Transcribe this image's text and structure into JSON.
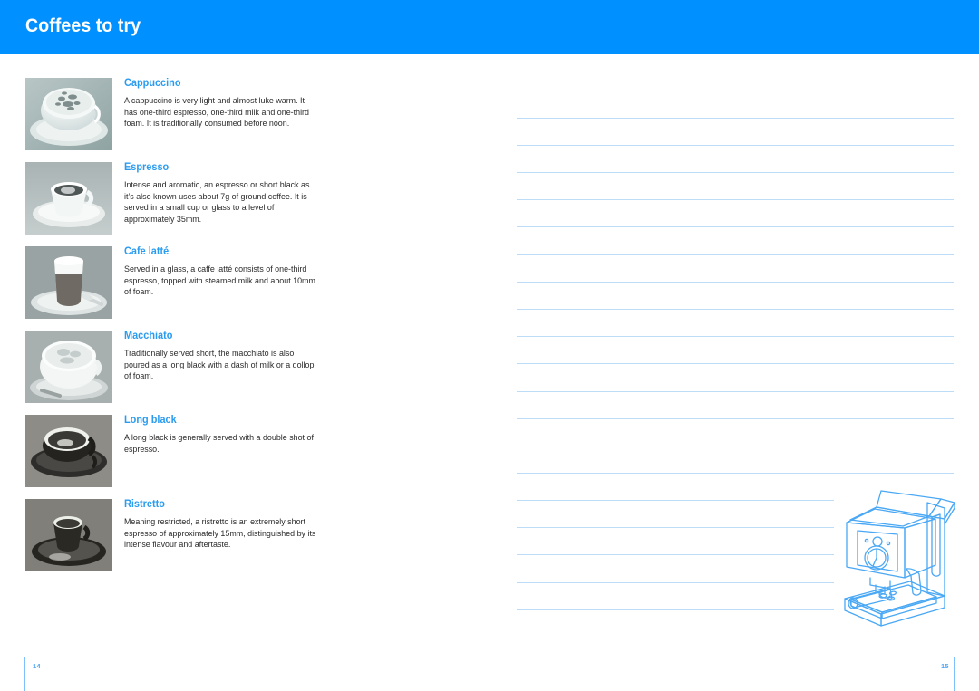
{
  "header": {
    "title": "Coffees to try",
    "bar_color": "#0090ff"
  },
  "theme": {
    "accent_blue": "#0090ff",
    "heading_blue": "#2a9cf0",
    "rule_line_blue": "#bcdcf8",
    "body_text": "#2b2b2b",
    "page_number_blue": "#4da6f5"
  },
  "coffees": [
    {
      "name": "Cappuccino",
      "description": "A cappuccino is very light and almost luke warm. It has one-third espresso, one-third milk and one-third foam. It is traditionally consumed before noon.",
      "thumbnail": "cappuccino-cup-photo"
    },
    {
      "name": "Espresso",
      "description": "Intense and aromatic, an espresso or short black as it’s also known uses about 7g of ground coffee. It is served in a small cup or glass to a level of approximately 35mm.",
      "thumbnail": "espresso-cup-photo"
    },
    {
      "name": "Cafe latté",
      "description": "Served in a glass, a caffe latté consists of one-third espresso, topped with steamed milk and about 10mm of foam.",
      "thumbnail": "cafe-latte-glass-photo"
    },
    {
      "name": "Macchiato",
      "description": "Traditionally served short, the macchiato is also poured as a long black with a dash of milk or a dollop of foam.",
      "thumbnail": "macchiato-cup-photo"
    },
    {
      "name": "Long black",
      "description": "A long black is generally served with a double shot of espresso.",
      "thumbnail": "long-black-cup-photo"
    },
    {
      "name": "Ristretto",
      "description": "Meaning restricted, a ristretto is an extremely short espresso of approximately 15mm, distinguished by its intense flavour and aftertaste.",
      "thumbnail": "ristretto-cup-photo"
    }
  ],
  "notes_area": {
    "icon": "espresso-machine-line-drawing",
    "line_count": 19
  },
  "footer": {
    "page_left": "14",
    "page_right": "15"
  }
}
